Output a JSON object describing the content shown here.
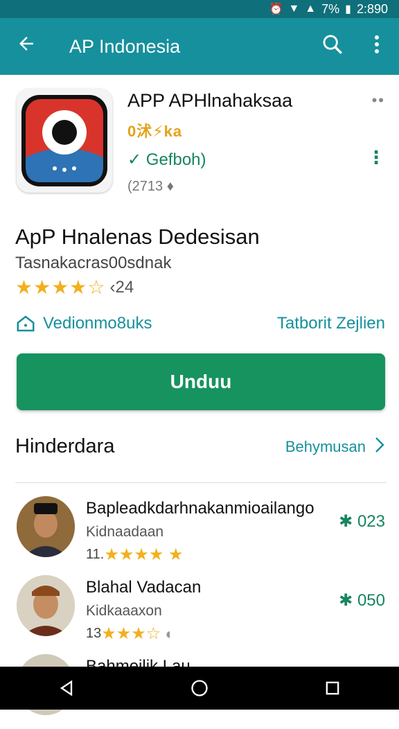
{
  "status_bar": {
    "battery_percent": "7%",
    "time": "2:890"
  },
  "app_bar": {
    "title": "AP Indonesia"
  },
  "app_header": {
    "app_name": "APP APHlnahaksaa",
    "developer": "0沭⚡ka",
    "category": "Gefboh)",
    "size": "(2713 ♦"
  },
  "detail": {
    "headline": "ApP Hnalenas Dedesisan",
    "subline": "Tasnakacras00sdnak",
    "stars": "★★★★☆",
    "rating_count": "‹24",
    "left_link": "Vedionmo8uks",
    "right_link": "Tatborit Zejlien"
  },
  "install_button": {
    "label": "Unduu"
  },
  "section": {
    "title": "Hinderdara",
    "more_label": "Behymusan"
  },
  "reviews": [
    {
      "name": "Bapleadkdarhnakanmioailango",
      "sub": "Kidnaadaan",
      "rating_text": "11.",
      "stars": "★★★★ ★",
      "score": "✱ 023"
    },
    {
      "name": "Blahal Vadacan",
      "sub": "Kidkaaaxon",
      "rating_text": "13",
      "stars": "★★★☆",
      "score": "✱ 050"
    },
    {
      "name": "Bahmeilik Lau",
      "sub": "",
      "rating_text": "",
      "stars": "",
      "score": ""
    }
  ],
  "colors": {
    "app_bar": "#16909c",
    "install": "#16935f",
    "star": "#f2b01e",
    "accent": "#16855e"
  }
}
